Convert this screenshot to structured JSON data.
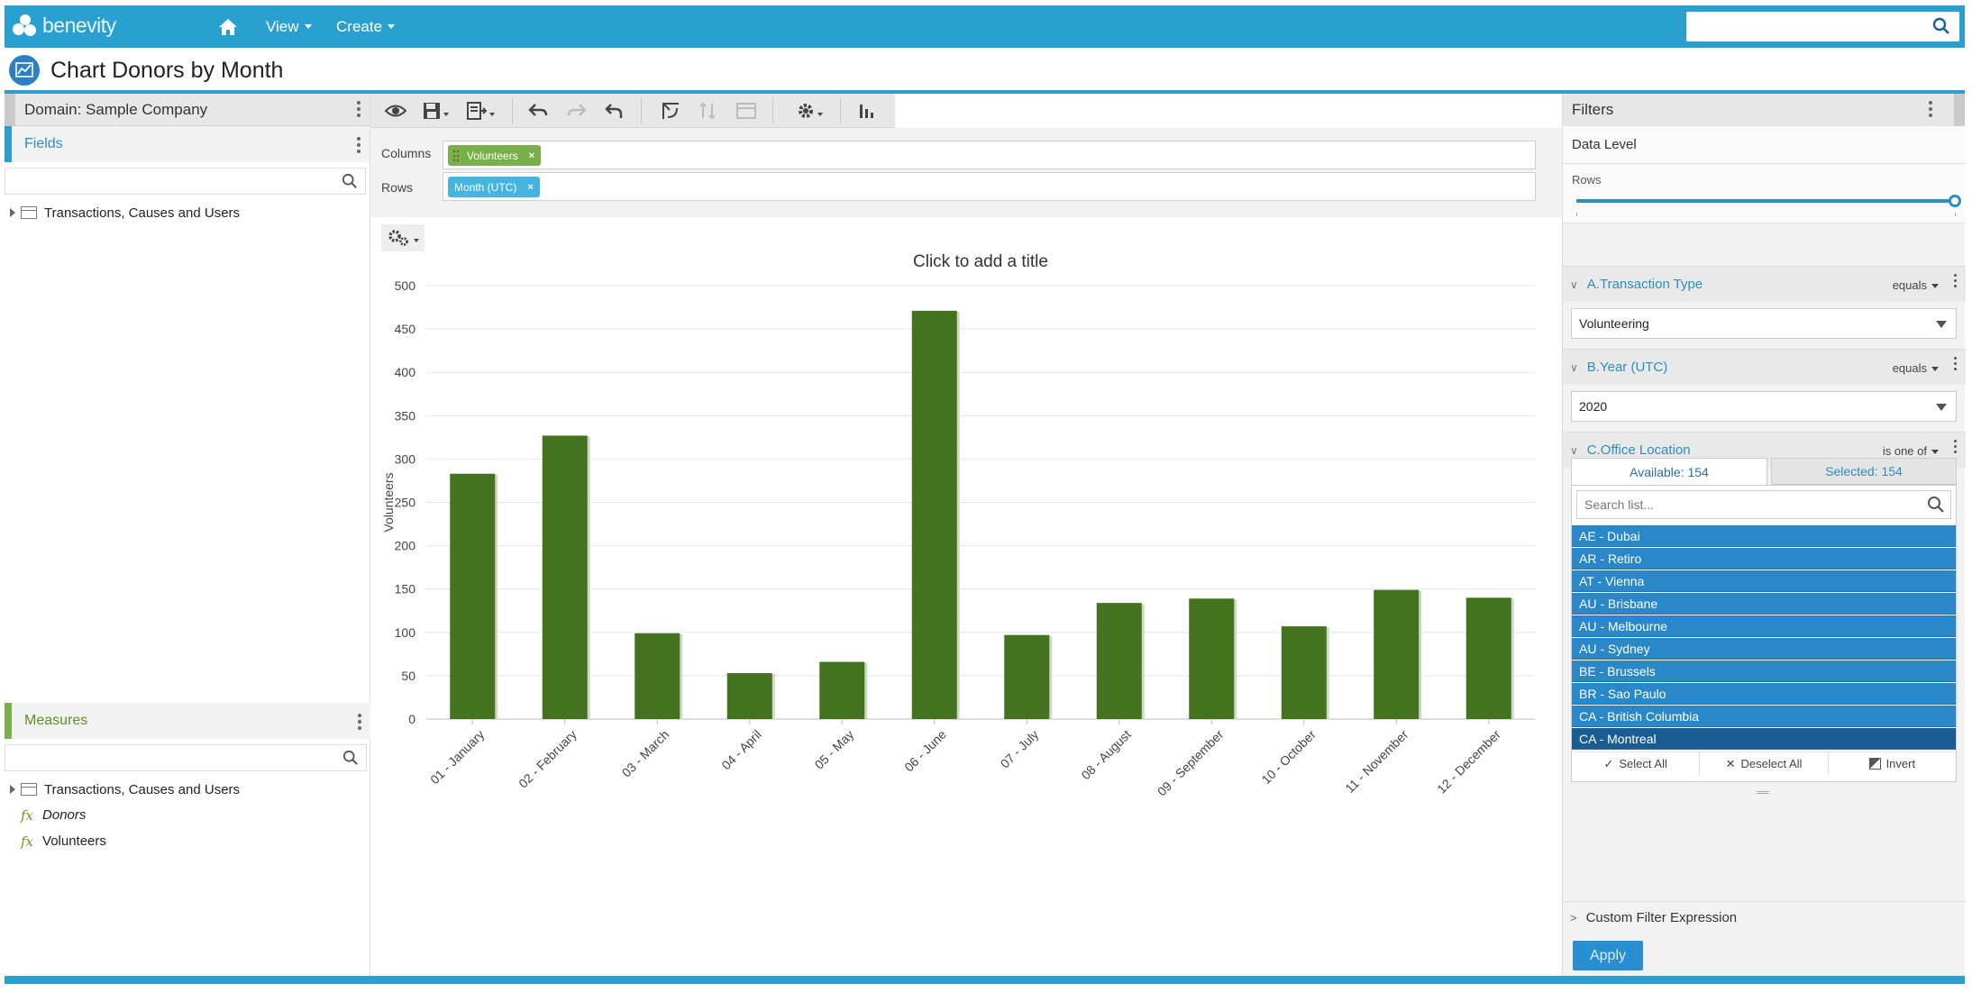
{
  "app": {
    "logo_text": "benevity",
    "nav": {
      "view_label": "View",
      "create_label": "Create"
    },
    "search_placeholder": ""
  },
  "page": {
    "title": "Chart Donors by Month"
  },
  "left_panel": {
    "domain_label": "Domain: Sample Company",
    "fields_label": "Fields",
    "fields_search_placeholder": "",
    "fields_tree": [
      "Transactions, Causes and Users"
    ],
    "measures_label": "Measures",
    "measures_search_placeholder": "",
    "measures_tree": [
      "Transactions, Causes and Users"
    ],
    "measures": [
      {
        "icon": "fx",
        "label": "Donors",
        "italic": true
      },
      {
        "icon": "fx",
        "label": "Volunteers",
        "italic": false
      }
    ]
  },
  "builder": {
    "columns_label": "Columns",
    "rows_label": "Rows",
    "columns_pill": "Volunteers",
    "rows_pill": "Month (UTC)",
    "pill_remove": "×",
    "colors": {
      "measure_pill": "#7ab04a",
      "field_pill": "#45b5e0"
    }
  },
  "chart_data": {
    "type": "bar",
    "title": "Click to add a title",
    "xlabel": "",
    "ylabel": "Volunteers",
    "ylim": [
      0,
      500
    ],
    "yticks": [
      0,
      50,
      100,
      150,
      200,
      250,
      300,
      350,
      400,
      450,
      500
    ],
    "grid": true,
    "legend": "none",
    "bar_color": "#447320",
    "categories": [
      "01 - January",
      "02 - February",
      "03 - March",
      "04 - April",
      "05 - May",
      "06 - June",
      "07 - July",
      "08 - August",
      "09 - September",
      "10 - October",
      "11 - November",
      "12 - December"
    ],
    "series": [
      {
        "values": [
          283,
          327,
          99,
          53,
          66,
          471,
          97,
          134,
          139,
          107,
          149,
          140
        ]
      }
    ]
  },
  "filters_panel": {
    "title": "Filters",
    "data_level_label": "Data Level",
    "rows_label": "Rows",
    "filters": [
      {
        "name": "A.Transaction Type",
        "operator": "equals",
        "value": "Volunteering"
      },
      {
        "name": "B.Year (UTC)",
        "operator": "equals",
        "value": "2020"
      },
      {
        "name": "C.Office Location",
        "operator": "is one of"
      }
    ],
    "available_tab": "Available: 154",
    "selected_tab": "Selected: 154",
    "list_search_placeholder": "Search list...",
    "list_items": [
      "AE - Dubai",
      "AR - Retiro",
      "AT - Vienna",
      "AU - Brisbane",
      "AU - Melbourne",
      "AU - Sydney",
      "BE - Brussels",
      "BR - Sao Paulo",
      "CA - British Columbia",
      "CA - Montreal"
    ],
    "select_all": "Select All",
    "deselect_all": "Deselect All",
    "invert": "Invert",
    "custom_filter_label": "Custom Filter Expression",
    "apply_label": "Apply"
  }
}
